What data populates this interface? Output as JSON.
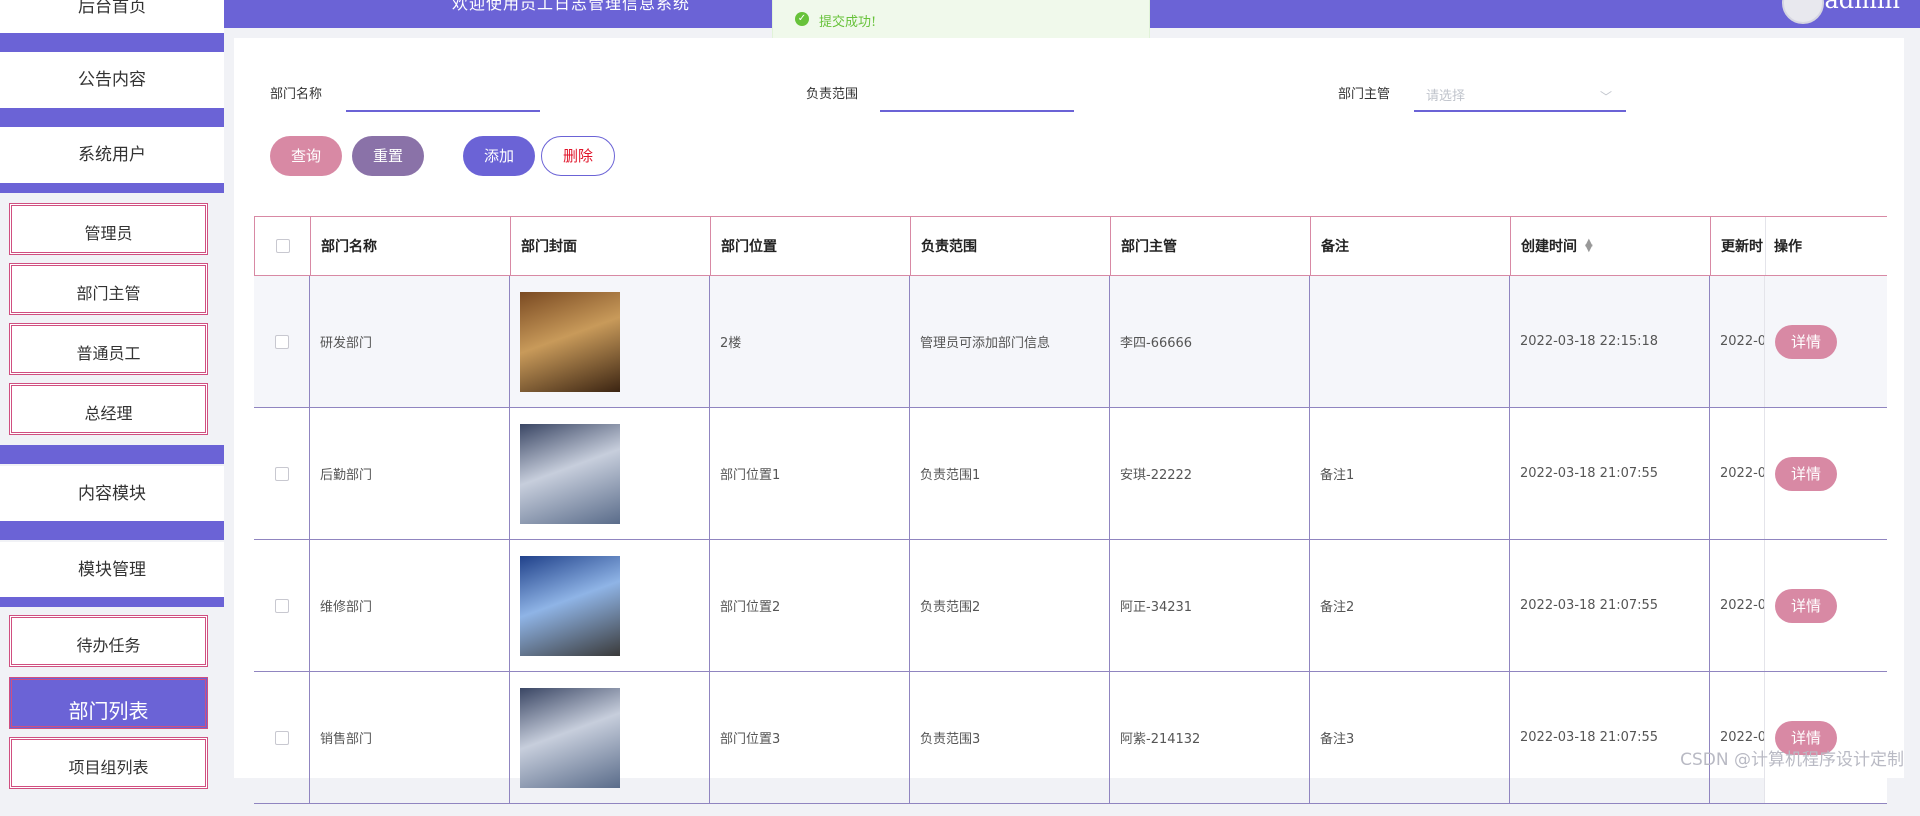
{
  "topbar": {
    "welcome": "欢迎使用员工日志管理信息系统",
    "user": "admin"
  },
  "toast": {
    "message": "提交成功!"
  },
  "sidebar": {
    "top_item": "后台首页",
    "groups": [
      {
        "label": "公告内容"
      },
      {
        "label": "系统用户",
        "items": [
          "管理员",
          "部门主管",
          "普通员工",
          "总经理"
        ]
      },
      {
        "label": "内容模块"
      },
      {
        "label": "模块管理",
        "items": [
          "待办任务",
          "部门列表",
          "项目组列表"
        ]
      }
    ],
    "active_item": "部门列表"
  },
  "filters": {
    "dept_name_label": "部门名称",
    "dept_name_value": "",
    "scope_label": "负责范围",
    "scope_value": "",
    "manager_label": "部门主管",
    "manager_placeholder": "请选择"
  },
  "buttons": {
    "query": "查询",
    "reset": "重置",
    "add": "添加",
    "delete": "删除"
  },
  "table": {
    "headers": [
      "部门名称",
      "部门封面",
      "部门位置",
      "负责范围",
      "部门主管",
      "备注",
      "创建时间",
      "更新时",
      "操作"
    ],
    "rows": [
      {
        "name": "研发部门",
        "location": "2楼",
        "scope": "管理员可添加部门信息",
        "manager": "李四-66666",
        "note": "",
        "created": "2022-03-18 22:15:18",
        "updated": "2022-0",
        "action": "详情"
      },
      {
        "name": "后勤部门",
        "location": "部门位置1",
        "scope": "负责范围1",
        "manager": "安琪-22222",
        "note": "备注1",
        "created": "2022-03-18 21:07:55",
        "updated": "2022-0",
        "action": "详情"
      },
      {
        "name": "维修部门",
        "location": "部门位置2",
        "scope": "负责范围2",
        "manager": "阿正-34231",
        "note": "备注2",
        "created": "2022-03-18 21:07:55",
        "updated": "2022-0",
        "action": "详情"
      },
      {
        "name": "销售部门",
        "location": "部门位置3",
        "scope": "负责范围3",
        "manager": "阿紫-214132",
        "note": "备注3",
        "created": "2022-03-18 21:07:55",
        "updated": "2022-0",
        "action": "详情"
      }
    ]
  },
  "watermark": "CSDN @计算机程序设计定制",
  "colors": {
    "primary": "#6b63d6",
    "pink": "#d889a4",
    "mauve": "#8a72a8",
    "danger": "#e0142a",
    "success": "#67c23a"
  }
}
